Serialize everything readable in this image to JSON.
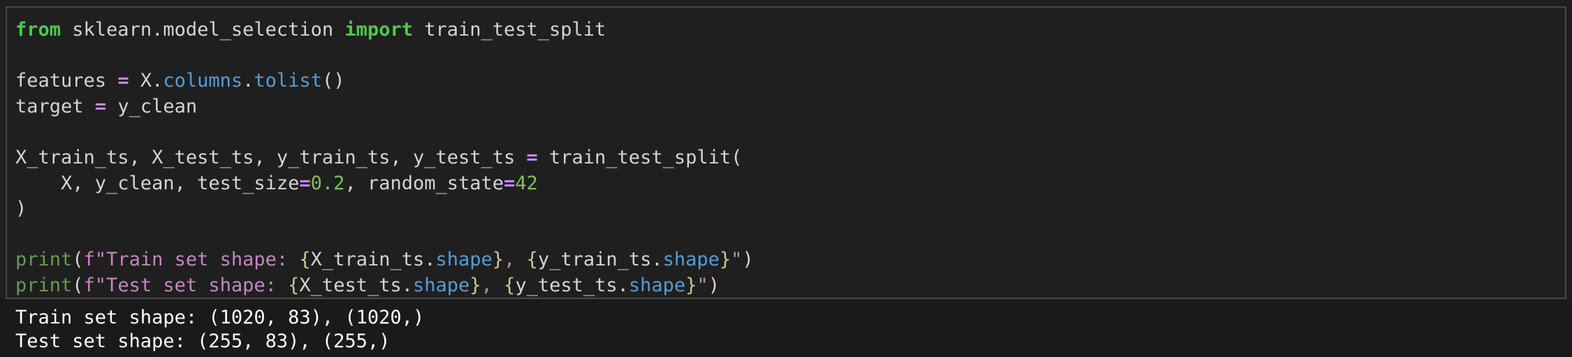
{
  "code": {
    "line1": {
      "kw_from": "from",
      "module": " sklearn.model_selection ",
      "kw_import": "import",
      "name": " train_test_split"
    },
    "line3": {
      "var": "features ",
      "eq": "=",
      "obj": " X.",
      "attr1": "columns",
      "dot": ".",
      "attr2": "tolist",
      "paren": "()"
    },
    "line4": {
      "var": "target ",
      "eq": "=",
      "val": " y_clean"
    },
    "line6": {
      "vars": "X_train_ts, X_test_ts, y_train_ts, y_test_ts ",
      "eq": "=",
      "call": " train_test_split("
    },
    "line7": {
      "args1": "    X, y_clean, test_size",
      "eq1": "=",
      "num1": "0.2",
      "args2": ", random_state",
      "eq2": "=",
      "num2": "42"
    },
    "line8": {
      "close": ")"
    },
    "line10": {
      "fn": "print",
      "open": "(",
      "prefix": "f\"Train set shape: ",
      "b1": "{",
      "v1": "X_train_ts.",
      "a1": "shape",
      "b2": "}",
      "sep": ", ",
      "b3": "{",
      "v2": "y_train_ts.",
      "a2": "shape",
      "b4": "}",
      "end": "\"",
      "close": ")"
    },
    "line11": {
      "fn": "print",
      "open": "(",
      "prefix": "f\"Test set shape: ",
      "b1": "{",
      "v1": "X_test_ts.",
      "a1": "shape",
      "b2": "}",
      "sep": ", ",
      "b3": "{",
      "v2": "y_test_ts.",
      "a2": "shape",
      "b4": "}",
      "end": "\"",
      "close": ")"
    }
  },
  "output": {
    "line1": "Train set shape: (1020, 83), (1020,)",
    "line2": "Test set shape: (255, 83), (255,)"
  }
}
